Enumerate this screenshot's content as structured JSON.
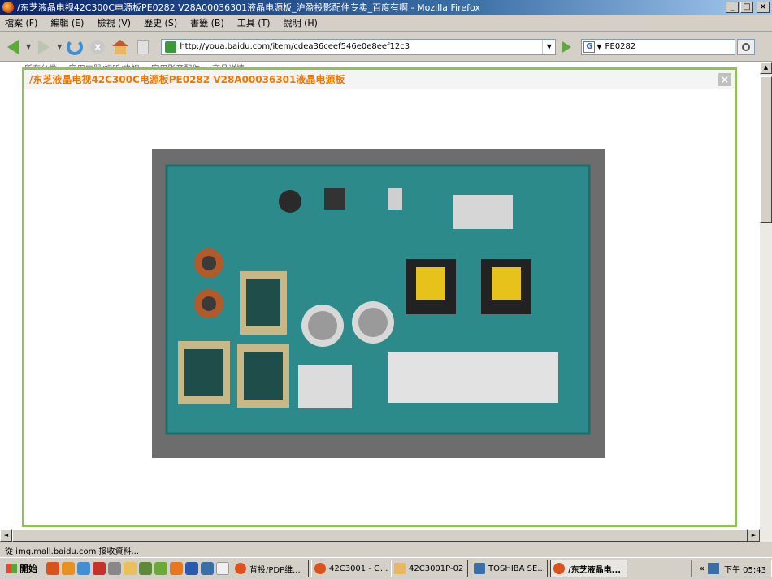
{
  "window": {
    "title": "/东芝液晶电视42C300C电源板PE0282 V28A00036301液晶电源板_沪盈投影配件专卖_百度有啊 - Mozilla Firefox",
    "btn_min": "_",
    "btn_max": "□",
    "btn_close": "×"
  },
  "menu": [
    {
      "label": "檔案 (F)"
    },
    {
      "label": "編輯 (E)"
    },
    {
      "label": "檢視 (V)"
    },
    {
      "label": "歷史 (S)"
    },
    {
      "label": "書籤 (B)"
    },
    {
      "label": "工具 (T)"
    },
    {
      "label": "說明 (H)"
    }
  ],
  "nav": {
    "url": "http://youa.baidu.com/item/cdea36ceef546e0e8eef12c3",
    "search_value": "PE0282",
    "search_engine": "G"
  },
  "page": {
    "breadcrumb": "所有分类 > 家用电器/视听/电视 > 家用影音配件 > 商品详情",
    "modal_title": "/东芝液晶电视42C300C电源板PE0282 V28A00036301液晶电源板",
    "modal_close": "×",
    "photo_alt": "circuit board photo"
  },
  "status": {
    "text": "從 img.mall.baidu.com 接收資料..."
  },
  "taskbar": {
    "start": "開始",
    "tasks": [
      {
        "label": "背投/PDP维...",
        "color": "#d9531e",
        "active": false
      },
      {
        "label": "42C3001 - G...",
        "color": "#d9531e",
        "active": false
      },
      {
        "label": "42C3001P-02",
        "color": "#e8b860",
        "active": false
      },
      {
        "label": "TOSHIBA SE...",
        "color": "#3a6ea5",
        "active": false
      },
      {
        "label": "/东芝液晶电...",
        "color": "#d9531e",
        "active": true
      }
    ],
    "chevron": "«",
    "clock": "下午 05:43"
  },
  "colors": {
    "modal_border": "#8fc156",
    "modal_title": "#f07800",
    "title_bar": "#0a246a"
  }
}
